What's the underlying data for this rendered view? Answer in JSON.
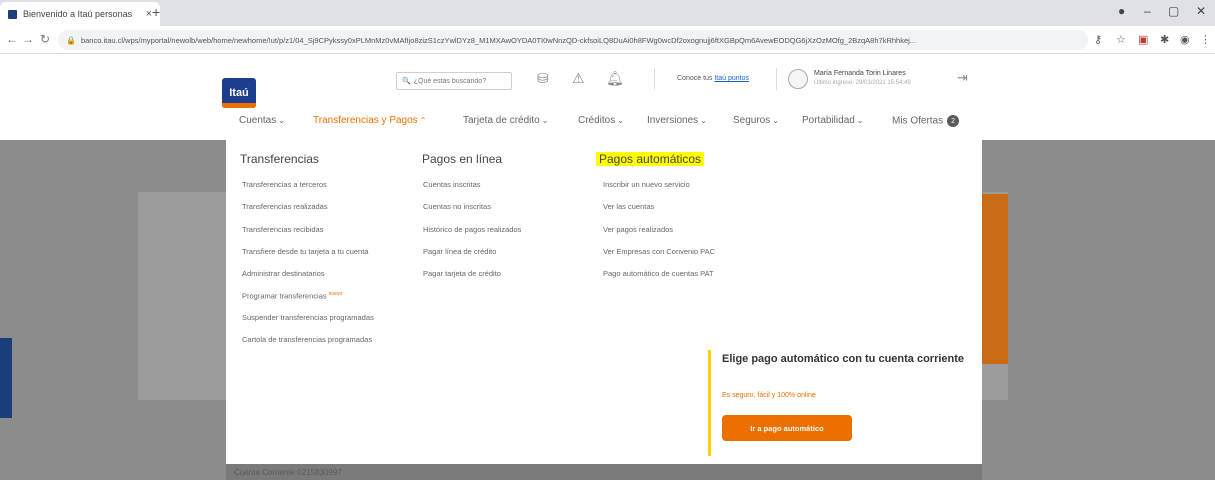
{
  "browser": {
    "tab_title": "Bienvenido a Itaú personas",
    "tab_close": "×",
    "new_tab": "+",
    "url": "banco.itau.cl/wps/myportal/newolb/web/home/newhome/!ut/p/z1/04_Sj9CPykssy0xPLMnMz0vMAfIjo8zizS1czYwlDYz8_M1MXAwOYDA0TI0wNnzQD-ckfsoiLQ8DuAi0h8FWg0wcDf2oxognujj6ftXGBpQm6AvewEODQG6jXzOzMOfg_2BzqA8h7kRhhkej..."
  },
  "header": {
    "logo_text": "Itaú",
    "search_placeholder": "¿Qué estás buscando?",
    "points_prefix": "Conoce tus ",
    "points_link": "Itaú puntos",
    "user_name": "María Fernanda Torin Linares",
    "last_login": "Último ingreso: 29/03/2021 15:54:49"
  },
  "nav": {
    "items": [
      {
        "label": "Cuentas"
      },
      {
        "label": "Transferencias y Pagos"
      },
      {
        "label": "Tarjeta de crédito"
      },
      {
        "label": "Créditos"
      },
      {
        "label": "Inversiones"
      },
      {
        "label": "Seguros"
      },
      {
        "label": "Portabilidad"
      },
      {
        "label": "Mis Ofertas"
      }
    ],
    "offers_badge": "2",
    "active_index": 1
  },
  "menu": {
    "transferencias": {
      "title": "Transferencias",
      "links": [
        "Transferencias a terceros",
        "Transferencias realizadas",
        "Transferencias recibidas",
        "Transfiere desde tu tarjeta a tu cuenta",
        "Administrar destinatarios",
        "Programar transferencias",
        "Suspender transferencias programadas",
        "Cartola de transferencias programadas"
      ],
      "new_tag": "nuevo"
    },
    "pagos_linea": {
      "title": "Pagos en línea",
      "links": [
        "Cuentas inscritas",
        "Cuentas no inscritas",
        "Histórico de pagos realizados",
        "Pagar línea de crédito",
        "Pagar tarjeta de crédito"
      ]
    },
    "pagos_auto": {
      "title": "Pagos automáticos",
      "links": [
        "Inscribir un nuevo servicio",
        "Ver las cuentas",
        "Ver pagos realizados",
        "Ver Empresas con Convenio PAC",
        "Pago automático de cuentas PAT"
      ]
    }
  },
  "promo": {
    "title": "Elige pago automático con tu cuenta corriente",
    "subtitle": "Es seguro, fácil y 100% online",
    "button": "Ir a pago automático"
  },
  "footer": {
    "account": "Cuenta Corriente 0215830997"
  },
  "colors": {
    "brand_blue": "#1c3e8c",
    "brand_orange": "#ec7000",
    "highlight": "#ffff00"
  }
}
